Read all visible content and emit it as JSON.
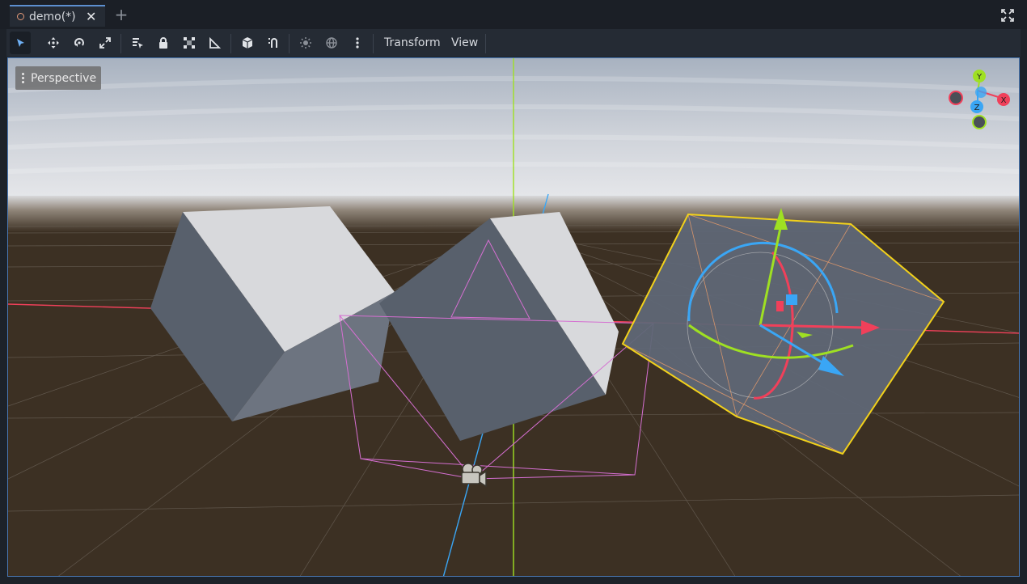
{
  "tabs": {
    "items": [
      {
        "label": "demo(*)",
        "modified": true
      }
    ],
    "new_tab": "+",
    "close_glyph": "✕"
  },
  "toolbar": {
    "tools": [
      {
        "name": "select-tool",
        "icon": "cursor-arrow-icon",
        "active": true
      },
      {
        "name": "move-tool",
        "icon": "move-cross-icon"
      },
      {
        "name": "rotate-tool",
        "icon": "rotate-icon"
      },
      {
        "name": "scale-tool",
        "icon": "scale-icon"
      },
      {
        "name": "selectable-nodes-tool",
        "icon": "list-select-icon"
      },
      {
        "name": "lock-tool",
        "icon": "lock-icon"
      },
      {
        "name": "group-tool",
        "icon": "group-icon"
      },
      {
        "name": "ruler-tool",
        "icon": "ruler-icon"
      },
      {
        "name": "local-space-tool",
        "icon": "cube-icon"
      },
      {
        "name": "snap-tool",
        "icon": "snap-icon"
      },
      {
        "name": "sun-preview-tool",
        "icon": "sun-icon"
      },
      {
        "name": "environment-preview-tool",
        "icon": "globe-icon"
      },
      {
        "name": "more-options-tool",
        "icon": "vertical-dots-icon"
      }
    ],
    "menus": {
      "transform": "Transform",
      "view": "View"
    }
  },
  "viewport": {
    "view_menu_label": "Perspective",
    "gizmo": {
      "y": "Y",
      "x": "X",
      "z": "Z"
    },
    "colors": {
      "x_axis": "#f0405a",
      "y_axis": "#9fe022",
      "z_axis": "#3aa6f5",
      "selection": "#f2d11b",
      "camera_frustum": "#d56fd1",
      "floor": "#3c3023",
      "sky_top": "#a8b2c0"
    }
  }
}
